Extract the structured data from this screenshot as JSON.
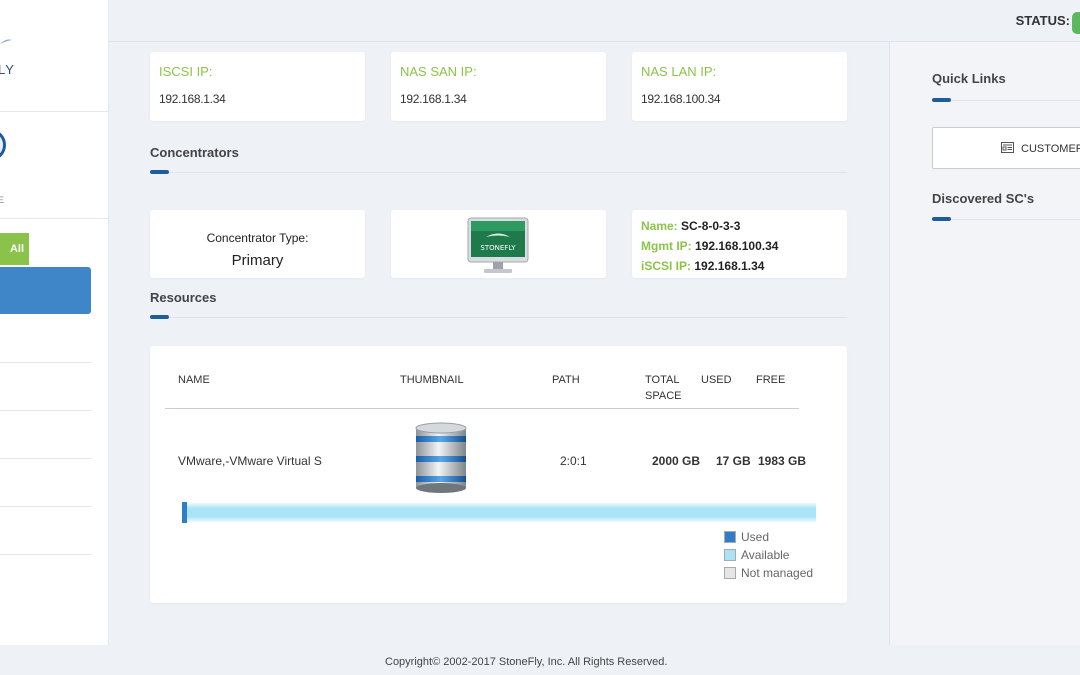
{
  "sidebar": {
    "logo_text": "LY",
    "avatar_sub": "E",
    "green_button": "All"
  },
  "header": {
    "status_label": "STATUS:"
  },
  "ip_cards": [
    {
      "label": "ISCSI IP:",
      "value": "192.168.1.34"
    },
    {
      "label": "NAS SAN IP:",
      "value": "192.168.1.34"
    },
    {
      "label": "NAS LAN IP:",
      "value": "192.168.100.34"
    }
  ],
  "concentrators": {
    "title": "Concentrators",
    "type_label": "Concentrator Type:",
    "type_value": "Primary",
    "monitor_brand": "STONEFLY",
    "details": [
      {
        "key": "Name:",
        "value": "SC-8-0-3-3"
      },
      {
        "key": "Mgmt IP:",
        "value": "192.168.100.34"
      },
      {
        "key": "iSCSI IP:",
        "value": "192.168.1.34"
      }
    ]
  },
  "resources": {
    "title": "Resources",
    "columns": {
      "name": "NAME",
      "thumbnail": "THUMBNAIL",
      "path": "PATH",
      "total_line1": "TOTAL",
      "total_line2": "SPACE",
      "used": "USED",
      "free": "FREE"
    },
    "rows": [
      {
        "name": "VMware,-VMware Virtual S",
        "path": "2:0:1",
        "total": "2000 GB",
        "used": "17 GB",
        "free": "1983 GB",
        "used_fraction": 0.0085
      }
    ],
    "legend": [
      {
        "label": "Used",
        "color": "#2f7cc7"
      },
      {
        "label": "Available",
        "color": "#a9e3f5"
      },
      {
        "label": "Not managed",
        "color": "#e6e6e6"
      }
    ]
  },
  "quick_links": {
    "title": "Quick Links",
    "customer_button": "CUSTOMER",
    "discovered_title": "Discovered SC's"
  },
  "footer": {
    "copyright": "Copyright© 2002-2017 StoneFly, Inc. All Rights Reserved."
  },
  "colors": {
    "accent_green": "#8bc34a",
    "accent_blue": "#1f5c9c",
    "nav_active": "#3f86c9"
  }
}
